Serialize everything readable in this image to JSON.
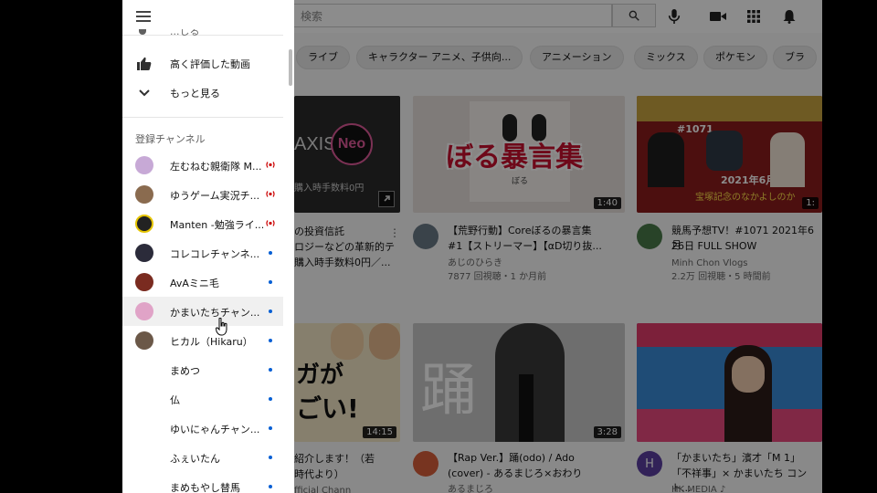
{
  "header": {
    "search_placeholder": "検索"
  },
  "chips": [
    "ライブ",
    "キャラクター アニメ、子供向...",
    "アニメーション",
    "ミックス",
    "ポケモン",
    "ブラ"
  ],
  "videos": [
    {
      "thumb_text_1": "AXIS",
      "thumb_text_2": "Neo",
      "thumb_text_3": "購入時手数料0円",
      "title_line1": "の投資信託",
      "title_line2": "ロジーなどの革新的テ",
      "title_line3": "購入時手数料0円／...",
      "duration": ""
    },
    {
      "thumb_text_1": "ぼる暴言集",
      "thumb_text_2": "ぼる",
      "title_line1": "【荒野行動】Coreぼるの暴言集",
      "title_line2": "#1【ストリーマー】【αD切り抜...",
      "channel": "あじのひらき",
      "meta": "7877 回視聴・1 か月前",
      "duration": "1:40"
    },
    {
      "thumb_text_1": "#1071",
      "thumb_text_2": "2021年6月26日",
      "thumb_text_3": "宝塚記念のなかよしのか",
      "title_line1": "競馬予想TV！#1071 2021年6月",
      "title_line2": "26日 FULL SHOW",
      "channel": "Minh Chon Vlogs",
      "meta": "2.2万 回視聴・5 時間前",
      "duration": "1:"
    },
    {
      "thumb_text_1": "ガが",
      "thumb_text_2": "ごい!",
      "title_line1": "紹介します！（若",
      "title_line2": "時代より）",
      "channel": "fficial Chann",
      "duration": "14:15"
    },
    {
      "thumb_text_1": "踊",
      "title_line1": "【Rap Ver.】踊(odo) / Ado",
      "title_line2": "(cover) - あるまじろ×おわり",
      "channel": "あるまじろ",
      "duration": "3:28"
    },
    {
      "title_line1": "「かまいたち」濱才「M 1」",
      "title_line2": "「不祥事」× かまいたち コント...",
      "channel": "HK MEDIA ♪",
      "avatar_letter": "H",
      "duration": ""
    }
  ],
  "drawer": {
    "top_partial_label": "...しる",
    "items": [
      {
        "label": "高く評価した動画",
        "icon": "thumb-up-icon"
      },
      {
        "label": "もっと見る",
        "icon": "chevron-down-icon"
      }
    ],
    "subscriptions_heading": "登録チャンネル",
    "subscriptions": [
      {
        "name": "左むねむ親衛隊 M...",
        "status": "live",
        "color": "#c7a9d6"
      },
      {
        "name": "ゆうゲーム実況チ...",
        "status": "live",
        "color": "#8a6b4f"
      },
      {
        "name": "Manten -勉強ライ...",
        "status": "live",
        "color": "#222222"
      },
      {
        "name": "コレコレチャンネ...",
        "status": "new",
        "color": "#2b2b3a"
      },
      {
        "name": "AvAミニ毛",
        "status": "new",
        "color": "#7a2b20"
      },
      {
        "name": "かまいたちチャン...",
        "status": "new",
        "color": "#e0a3c7"
      },
      {
        "name": "ヒカル（Hikaru）",
        "status": "new",
        "color": "#6b5848"
      },
      {
        "name": "まめつ",
        "status": "new",
        "color": ""
      },
      {
        "name": "仏",
        "status": "new",
        "color": ""
      },
      {
        "name": "ゆいにゃんチャン...",
        "status": "new",
        "color": ""
      },
      {
        "name": "ふぇいたん",
        "status": "new",
        "color": ""
      },
      {
        "name": "まめもやし替馬",
        "status": "new",
        "color": ""
      }
    ]
  },
  "colors": {
    "live_badge": "#cc0000",
    "new_dot": "#065fd4",
    "accent_red": "#c8102e"
  }
}
